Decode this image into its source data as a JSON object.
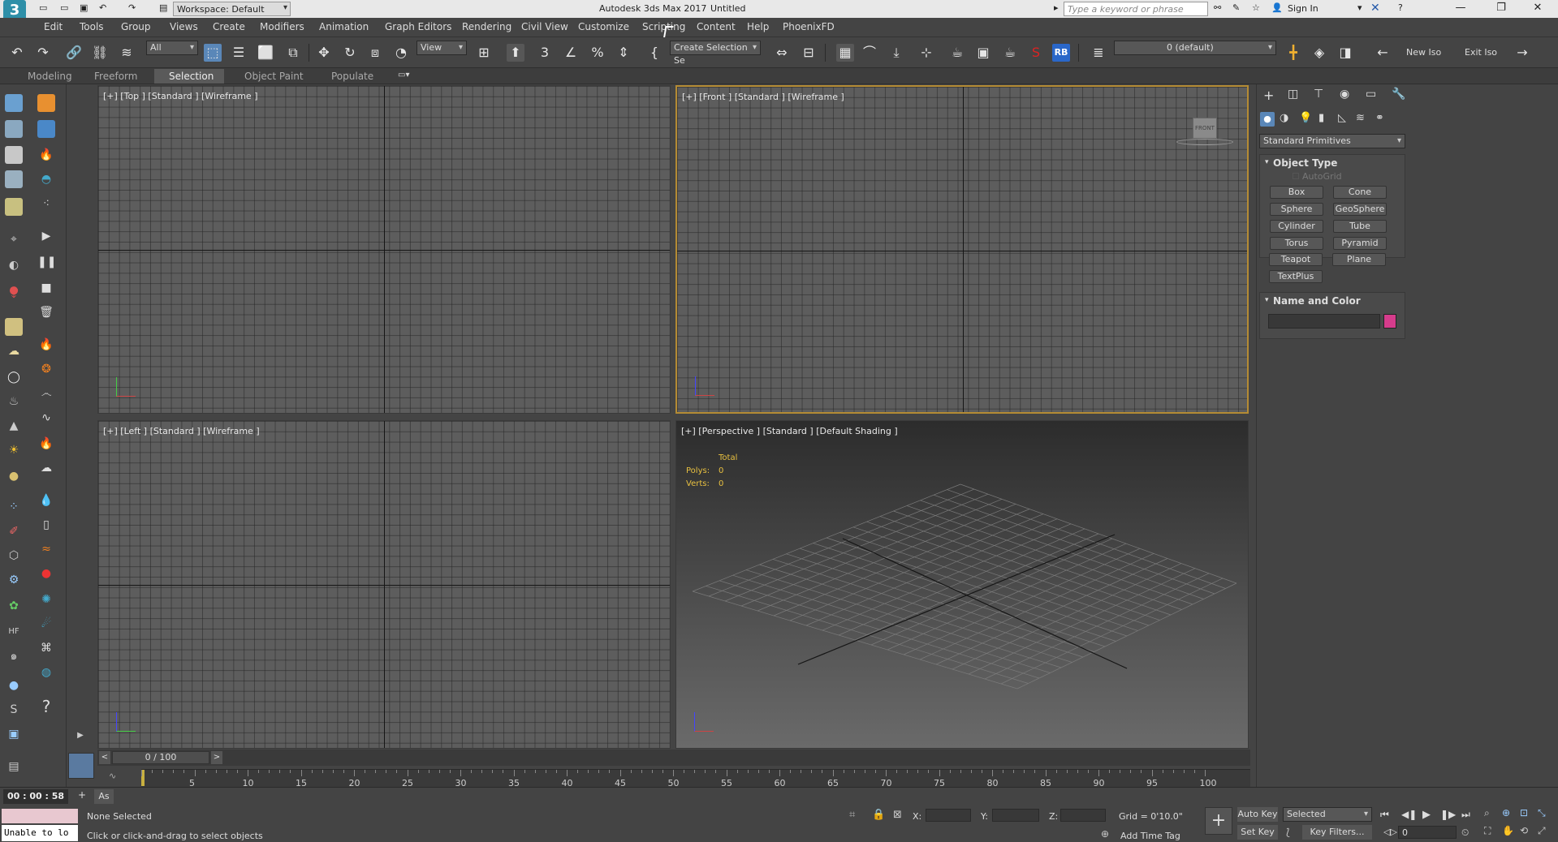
{
  "titlebar": {
    "workspace": "Workspace: Default",
    "app_title": "Autodesk 3ds Max 2017",
    "doc_title": "Untitled",
    "search_placeholder": "Type a keyword or phrase",
    "sign_in": "Sign In"
  },
  "menu": [
    "Edit",
    "Tools",
    "Group",
    "Views",
    "Create",
    "Modifiers",
    "Animation",
    "Graph Editors",
    "Rendering",
    "Civil View",
    "Customize",
    "Scripting",
    "Content",
    "Help",
    "PhoenixFD"
  ],
  "toolbar": {
    "filter_value": "All",
    "ref_coord_value": "View",
    "selection_set": "Create Selection Se",
    "layer_value": "0 (default)",
    "new_iso": "New Iso",
    "exit_iso": "Exit Iso",
    "rb_label": "RB"
  },
  "ribbon": {
    "tabs": [
      "Modeling",
      "Freeform",
      "Selection",
      "Object Paint",
      "Populate"
    ]
  },
  "viewports": {
    "top": "[+] [Top ] [Standard ] [Wireframe ]",
    "front": "[+] [Front ] [Standard ] [Wireframe ]",
    "left": "[+] [Left ] [Standard ] [Wireframe ]",
    "perspective": "[+] [Perspective ] [Standard ] [Default Shading ]",
    "stats": {
      "total": "Total",
      "polys_label": "Polys:",
      "polys_value": "0",
      "verts_label": "Verts:",
      "verts_value": "0"
    },
    "viewcube_label": "FRONT"
  },
  "command_panel": {
    "category": "Standard Primitives",
    "object_type_title": "Object Type",
    "autogrid": "AutoGrid",
    "buttons": [
      "Box",
      "Cone",
      "Sphere",
      "GeoSphere",
      "Cylinder",
      "Tube",
      "Torus",
      "Pyramid",
      "Teapot",
      "Plane",
      "TextPlus"
    ],
    "name_color_title": "Name and Color",
    "swatch_color": "#d63c8c"
  },
  "timeline": {
    "frame_display": "0 / 100",
    "ticks": [
      "5",
      "10",
      "15",
      "20",
      "25",
      "30",
      "35",
      "40",
      "45",
      "50",
      "55",
      "60",
      "65",
      "70",
      "75",
      "80",
      "85",
      "90",
      "95",
      "100"
    ]
  },
  "status": {
    "time": "00 : 00 : 58",
    "as_label": "As",
    "selection_status": "None Selected",
    "prompt": "Click or click-and-drag to select objects",
    "maxscript_text": "Unable to lo",
    "x_label": "X:",
    "y_label": "Y:",
    "z_label": "Z:",
    "grid": "Grid = 0'10.0\"",
    "add_time_tag": "Add Time Tag",
    "auto_key": "Auto Key",
    "set_key": "Set Key",
    "selected_value": "Selected",
    "key_filters": "Key Filters...",
    "frame_value": "0"
  }
}
